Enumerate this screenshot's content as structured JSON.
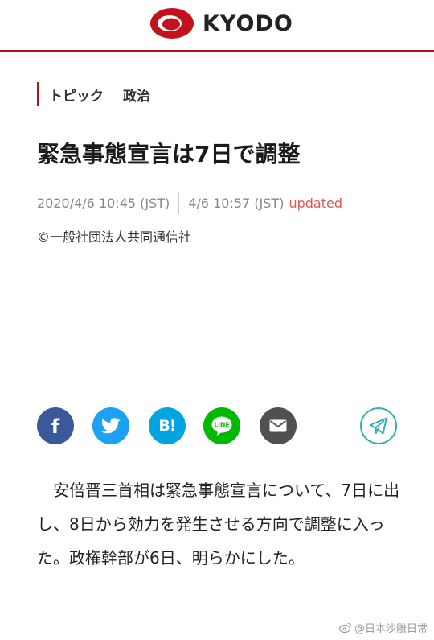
{
  "header": {
    "logo_text": "KYODO",
    "brand_color": "#b3121d"
  },
  "topic": {
    "label": "トピック",
    "category": "政治"
  },
  "article": {
    "title": "緊急事態宣言は7日で調整",
    "published": "2020/4/6 10:45 (JST)",
    "updated_time": "4/6 10:57 (JST)",
    "updated_label": "updated",
    "copyright": "©一般社団法人共同通信社",
    "body": "安倍晋三首相は緊急事態宣言について、7日に出し、8日から効力を発生させる方向で調整に入った。政権幹部が6日、明らかにした。"
  },
  "share": {
    "buttons": [
      {
        "icon": "facebook-icon",
        "color": "#3b5998"
      },
      {
        "icon": "twitter-icon",
        "color": "#1da1f2"
      },
      {
        "icon": "hatena-bookmark-icon",
        "color": "#00a4de",
        "glyph": "B!"
      },
      {
        "icon": "line-icon",
        "color": "#00b900",
        "glyph": "LINE"
      },
      {
        "icon": "mail-icon",
        "color": "#505050"
      },
      {
        "icon": "telegram-icon",
        "color": "#2fb3ad"
      }
    ]
  },
  "watermark": {
    "text": "@日本沙雕日常"
  }
}
